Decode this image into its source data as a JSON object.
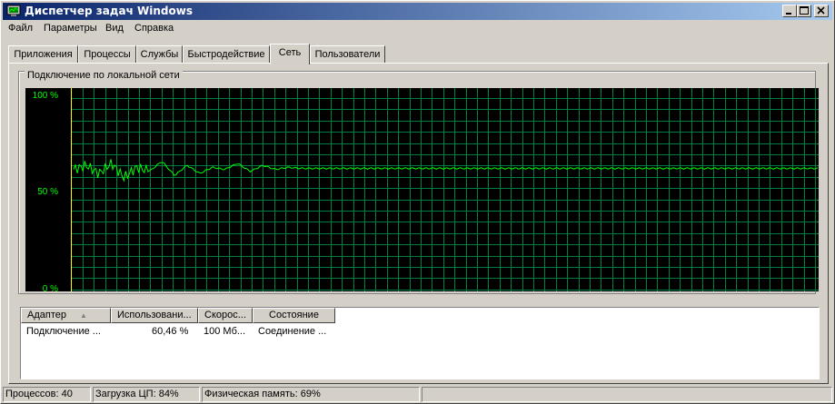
{
  "window": {
    "title": "Диспетчер задач Windows",
    "icon": "monitor-icon"
  },
  "menu": {
    "items": [
      "Файл",
      "Параметры",
      "Вид",
      "Справка"
    ]
  },
  "tabs": {
    "items": [
      "Приложения",
      "Процессы",
      "Службы",
      "Быстродействие",
      "Сеть",
      "Пользователи"
    ],
    "active": "Сеть"
  },
  "network": {
    "group_label": "Подключение по локальной сети",
    "y_labels": [
      "100 %",
      "50 %",
      "0 %"
    ]
  },
  "chart_data": {
    "type": "line",
    "title": "Подключение по локальной сети",
    "ylim": [
      0,
      100
    ],
    "y_ticks": [
      "100 %",
      "50 %",
      "0 %"
    ],
    "grid": true,
    "series": [
      {
        "color": "#00ff00",
        "values": [
          60,
          62,
          58,
          63,
          56,
          61,
          59,
          64,
          57,
          62,
          58,
          61,
          60,
          63,
          59,
          62,
          60,
          61,
          60.5,
          60.5,
          60.5,
          60.5,
          60.5,
          60.5,
          60.5,
          60.5,
          60.5,
          60.5,
          60.5,
          60.5,
          60.5,
          60.5,
          60.5,
          60.5,
          60.5,
          60.5,
          60.5,
          60.5,
          60.5,
          60.5,
          60.5,
          60.5,
          60.5,
          60.5,
          60.5,
          60.5,
          60.5,
          60.5,
          60.5,
          60.5,
          60.5,
          60.5,
          60.5,
          60.5,
          60.5,
          60.5,
          60.5,
          60.5,
          60.5,
          60.5
        ]
      }
    ]
  },
  "list": {
    "columns": [
      "Адаптер",
      "Использовани...",
      "Скорос...",
      "Состояние"
    ],
    "sort_icon": "sort-ascending-icon",
    "rows": [
      [
        "Подключение ...",
        "60,46 %",
        "100 Мб...",
        "Соединение ..."
      ]
    ]
  },
  "status": {
    "processes": "Процессов: 40",
    "cpu": "Загрузка ЦП: 84%",
    "memory": "Физическая память: 69%"
  },
  "colors": {
    "titlebar_start": "#0a246a",
    "titlebar_end": "#a6caf0",
    "graph_bg": "#000000",
    "grid": "#008040",
    "line": "#00ff00",
    "axis_label": "#00ff00"
  }
}
